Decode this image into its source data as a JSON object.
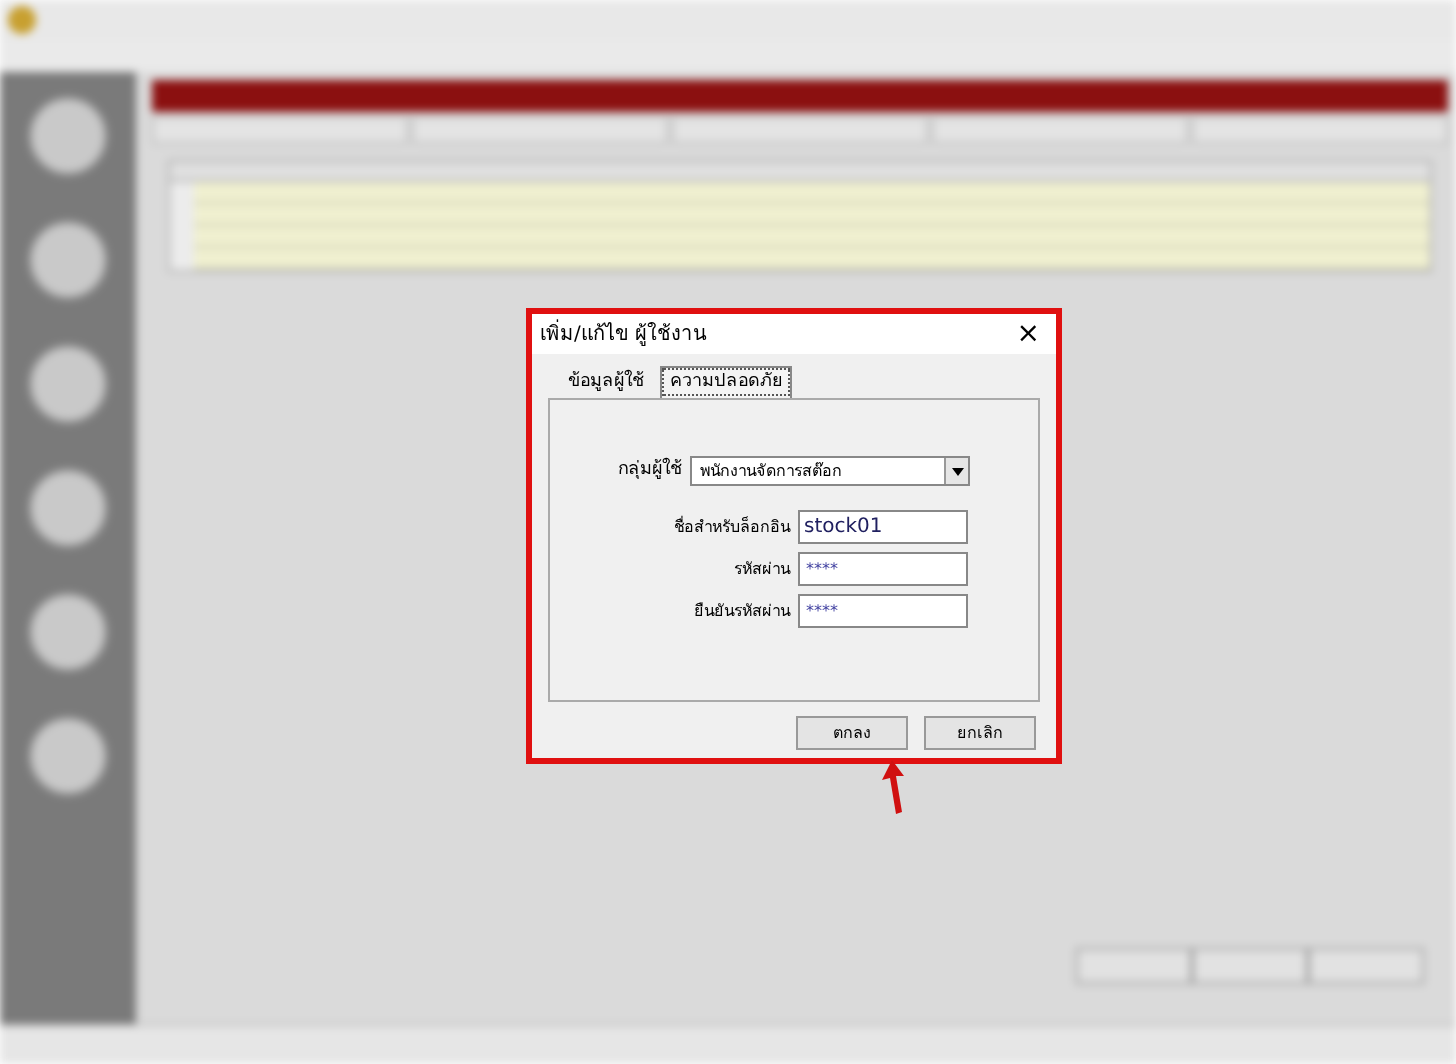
{
  "dialog": {
    "title": "เพิ่ม/แก้ไข ผู้ใช้งาน",
    "close": "×",
    "tabs": [
      {
        "label": "ข้อมูลผู้ใช้",
        "selected": false
      },
      {
        "label": "ความปลอดภัย",
        "selected": true
      }
    ],
    "fields": [
      {
        "kind": "select",
        "label": "กลุ่มผู้ใช้",
        "value": "พนักงานจัดการสต๊อก"
      },
      {
        "kind": "text",
        "label": "ชื่อสำหรับล็อกอิน",
        "value": "stock01"
      },
      {
        "kind": "password",
        "label": "รหัสผ่าน",
        "value": "****"
      },
      {
        "kind": "password",
        "label": "ยืนยันรหัสผ่าน",
        "value": "****"
      }
    ],
    "buttons": [
      "ตกลง",
      "ยกเลิก"
    ]
  }
}
